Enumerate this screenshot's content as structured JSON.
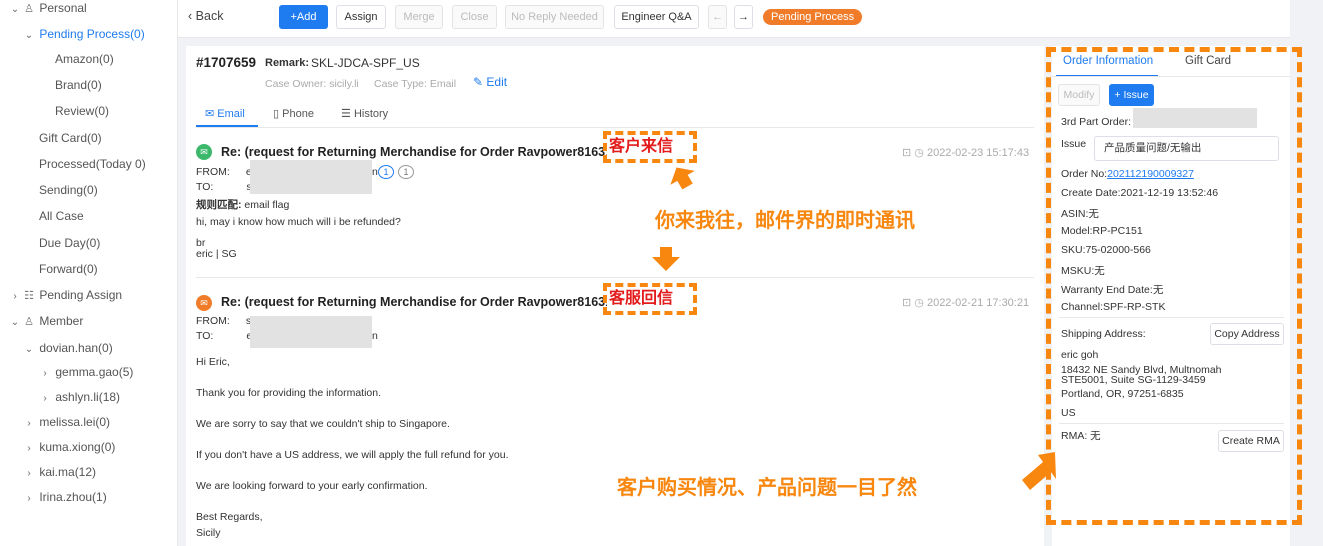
{
  "sidebar": {
    "personal": "Personal",
    "pending_process": "Pending Process(0)",
    "amazon": "Amazon(0)",
    "brand": "Brand(0)",
    "review": "Review(0)",
    "gift_card": "Gift Card(0)",
    "processed": "Processed(Today 0)",
    "sending": "Sending(0)",
    "all_case": "All Case",
    "due_day": "Due Day(0)",
    "forward": "Forward(0)",
    "pending_assign": "Pending Assign",
    "member": "Member",
    "dovian": "dovian.han(0)",
    "gemma": "gemma.gao(5)",
    "ashlyn": "ashlyn.li(18)",
    "melissa": "melissa.lei(0)",
    "kuma": "kuma.xiong(0)",
    "kai": "kai.ma(12)",
    "irina": "Irina.zhou(1)"
  },
  "toolbar": {
    "back": "Back",
    "add": "+Add",
    "assign": "Assign",
    "merge": "Merge",
    "close": "Close",
    "no_reply": "No Reply Needed",
    "engineer_qa": "Engineer Q&A",
    "status": "Pending Process"
  },
  "case": {
    "id": "#1707659",
    "remark_label": "Remark:",
    "remark_value": "SKL-JDCA-SPF_US",
    "owner": "Case Owner: sicily.li",
    "type": "Case Type: Email",
    "edit": "Edit",
    "tabs": [
      "Email",
      "Phone",
      "History"
    ]
  },
  "emails": [
    {
      "subject": "Re: (request for Returning Merchandise for Order Ravpower81631",
      "date": "2022-02-23 15:17:43",
      "from_label": "FROM:",
      "from_val": "e",
      "from_tail": "n",
      "badge1": "1",
      "badge2": "1",
      "to_label": "TO:",
      "to_val": "s",
      "rule_label": "规则匹配:",
      "rule_val": "email flag",
      "body": [
        "hi, may i know how much will i be refunded?",
        "br",
        "eric | SG"
      ]
    },
    {
      "subject": "Re: (request for Returning Merchandise for Order Ravpower81631",
      "date": "2022-02-21 17:30:21",
      "from_label": "FROM:",
      "from_val": "s",
      "to_label": "TO:",
      "to_val": "e",
      "to_tail": "n",
      "body": [
        "Hi Eric,",
        "Thank you for providing the information.",
        "We are sorry to say that we couldn't ship to Singapore.",
        "If you don't have a US address, we will apply the full refund for you.",
        "We are looking forward to your early confirmation.",
        "Best Regards,",
        "Sicily"
      ]
    }
  ],
  "order": {
    "tabs": [
      "Order Information",
      "Gift Card"
    ],
    "modify": "Modify",
    "issue_btn": "+ Issue",
    "third_party": "3rd Part Order:",
    "issue_label": "Issue",
    "issue_value": "产品质量问题/无输出",
    "order_no_label": "Order No:",
    "order_no": "202112190009327",
    "create_date": "Create Date:2021-12-19 13:52:46",
    "asin": "ASIN:无",
    "model": "Model:RP-PC151",
    "sku": "SKU:75-02000-566",
    "msku": "MSKU:无",
    "warranty": "Warranty End Date:无",
    "channel": "Channel:SPF-RP-STK",
    "shipping_label": "Shipping Address:",
    "copy_address": "Copy Address",
    "address": [
      "eric goh",
      "18432 NE Sandy Blvd, Multnomah",
      "STE5001, Suite SG-1129-3459",
      "Portland, OR, 97251-6835",
      "US"
    ],
    "rma": "RMA: 无",
    "create_rma": "Create RMA"
  },
  "annotations": {
    "customer_mail": "客户来信",
    "service_reply": "客服回信",
    "slogan1": "你来我往，邮件界的即时通讯",
    "slogan2": "客户购买情况、产品问题一目了然"
  },
  "colors": {
    "primary": "#1e7bf0",
    "accent": "#f7870f",
    "status": "#f07c2a",
    "label_red": "#e31b1b"
  }
}
